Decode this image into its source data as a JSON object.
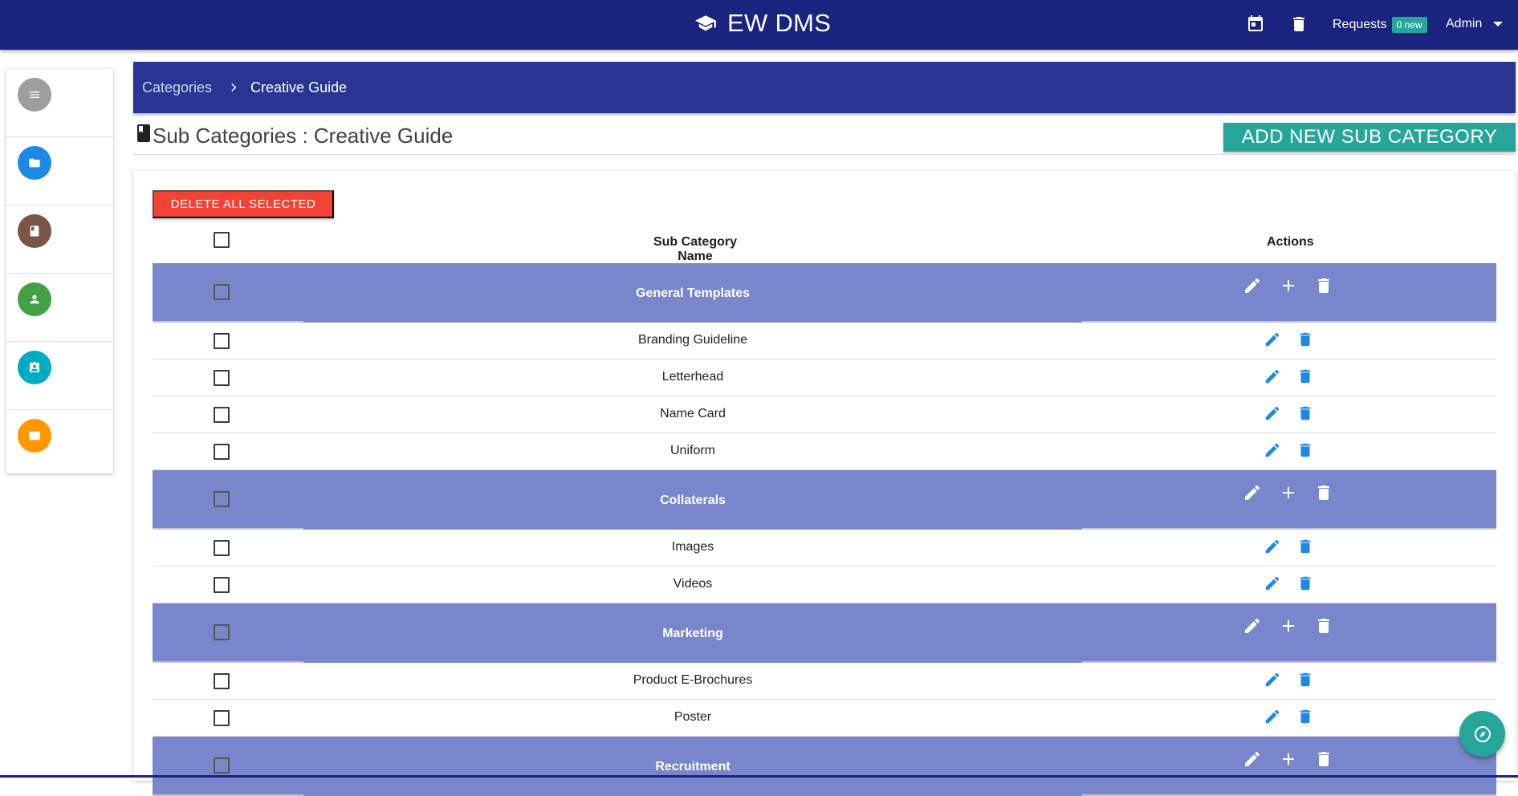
{
  "header": {
    "app_title": "EW DMS",
    "requests_label": "Requests",
    "requests_badge": "0 new",
    "user_label": "Admin"
  },
  "sidebar": {
    "items": [
      {
        "icon": "menu-icon",
        "color": "#9e9e9e"
      },
      {
        "icon": "folder-icon",
        "color": "#1e88e5"
      },
      {
        "icon": "book-icon",
        "color": "#795548"
      },
      {
        "icon": "person-icon",
        "color": "#43a047"
      },
      {
        "icon": "contact-card-icon",
        "color": "#00acc1"
      },
      {
        "icon": "card-icon",
        "color": "#ff9800"
      }
    ]
  },
  "breadcrumb": {
    "parent": "Categories",
    "current": "Creative Guide"
  },
  "page": {
    "title": "Sub Categories : Creative Guide",
    "add_button": "ADD NEW SUB CATEGORY",
    "delete_selected_button": "DELETE ALL SELECTED"
  },
  "table": {
    "columns": {
      "name": "Sub Category Name",
      "actions": "Actions"
    },
    "groups": [
      {
        "name": "General Templates",
        "items": [
          "Branding Guideline",
          "Letterhead",
          "Name Card",
          "Uniform"
        ]
      },
      {
        "name": "Collaterals",
        "items": [
          "Images",
          "Videos"
        ]
      },
      {
        "name": "Marketing",
        "items": [
          "Product E-Brochures",
          "Poster"
        ]
      },
      {
        "name": "Recruitment",
        "items": []
      }
    ]
  },
  "colors": {
    "topbar": "#1a237e",
    "breadcrumb_bar": "#283593",
    "group_row": "#7986cb",
    "accent": "#26a69a",
    "danger": "#f44336",
    "action_icon": "#1e88e5"
  }
}
